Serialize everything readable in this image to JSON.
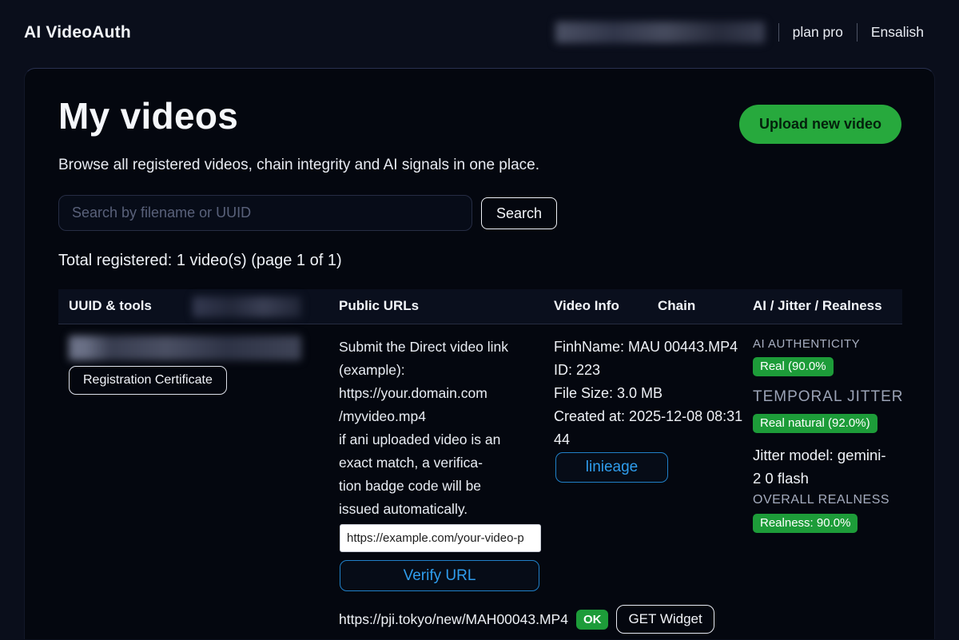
{
  "header": {
    "brand": "AI VideoAuth",
    "nav": [
      {
        "label": "plan pro"
      },
      {
        "label": "Ensalish"
      }
    ]
  },
  "page": {
    "title": "My videos",
    "subtitle": "Browse all registered videos, chain integrity and AI signals in one place.",
    "upload_button": "Upload new video",
    "search_placeholder": "Search by filename or UUID",
    "search_button": "Search",
    "total_line": "Total registered: 1 video(s) (page 1 of 1)"
  },
  "table": {
    "headers": [
      "UUID & tools",
      "Public URLs",
      "Video Info",
      "Chain",
      "AI / Jitter / Realness"
    ],
    "row": {
      "certificate_button": "Registration Certificate",
      "public_urls": {
        "instructions": "Submit the Direct video link\n(example):\nhttps://your.domain.com\n/myvideo.mp4\nif ani uploaded video is an\nexact match, a verifica-\ntion badge code will be\nissued automatically.",
        "verify_input_value": "https://example.com/your-video-p",
        "verify_button": "Verify URL",
        "verified_url": "https://pji.tokyo/new/MAH00043.MP4",
        "verified_status": "OK",
        "widget_button": "GET Widget"
      },
      "video_info": {
        "filename": "FinhName: MAU 00443.MP4",
        "id": "ID: 223",
        "file_size": "File Size: 3.0 MB",
        "created_at": "Created at: 2025-12-08 08:31\n44",
        "lineage_button": "linieage"
      },
      "ai": {
        "authenticity_label": "AI AUTHENTICITY",
        "authenticity_badge": "Real (90.0%",
        "jitter_label": "TEMPORAL JITTER",
        "jitter_badge": "Real natural (92.0%)",
        "jitter_model": "Jitter model: gemini-\n2 0 flash",
        "realness_label": "OVERALL REALNESS",
        "realness_badge": "Realness: 90.0%"
      }
    }
  },
  "colors": {
    "accent_green": "#27a93d",
    "badge_green": "#1d9c39",
    "accent_blue": "#2f9ded",
    "page_bg": "#0a0e1b",
    "panel_bg": "#04070f"
  }
}
